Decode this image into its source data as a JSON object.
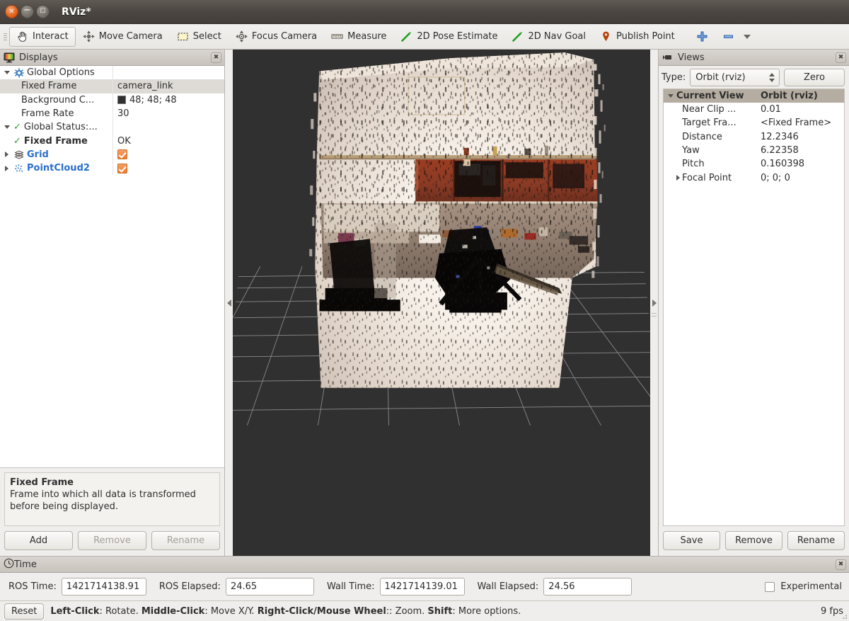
{
  "window": {
    "title": "RViz*",
    "controls": {
      "close": "close-button",
      "minimize": "minimize-button",
      "maximize": "maximize-button"
    }
  },
  "toolbar": {
    "items": [
      {
        "label": "Interact",
        "icon": "hand-cursor-icon",
        "active": true
      },
      {
        "label": "Move Camera",
        "icon": "move-camera-icon",
        "active": false
      },
      {
        "label": "Select",
        "icon": "select-rectangle-icon",
        "active": false
      },
      {
        "label": "Focus Camera",
        "icon": "focus-camera-icon",
        "active": false
      },
      {
        "label": "Measure",
        "icon": "ruler-icon",
        "active": false
      },
      {
        "label": "2D Pose Estimate",
        "icon": "pose-arrow-icon",
        "active": false
      },
      {
        "label": "2D Nav Goal",
        "icon": "nav-goal-arrow-icon",
        "active": false
      },
      {
        "label": "Publish Point",
        "icon": "map-pin-icon",
        "active": false
      }
    ],
    "add_tool_icon": "plus-icon",
    "remove_tool_icon": "minus-icon",
    "overflow_icon": "chevron-down-icon"
  },
  "displays_panel": {
    "title": "Displays",
    "icon": "displays-monitor-icon",
    "close_icon": "close-icon",
    "rows": [
      {
        "indent": 0,
        "twisty": "down",
        "icon": "gear-icon",
        "status": "",
        "label": "Global Options",
        "value": "",
        "value_kind": "none",
        "selected": false,
        "link": false
      },
      {
        "indent": 1,
        "twisty": "none",
        "icon": "none",
        "status": "",
        "label": "Fixed Frame",
        "value": "camera_link",
        "value_kind": "text",
        "selected": true,
        "link": false
      },
      {
        "indent": 1,
        "twisty": "none",
        "icon": "none",
        "status": "",
        "label": "Background C...",
        "value": "48; 48; 48",
        "value_kind": "color",
        "selected": false,
        "link": false
      },
      {
        "indent": 1,
        "twisty": "none",
        "icon": "none",
        "status": "",
        "label": "Frame Rate",
        "value": "30",
        "value_kind": "text",
        "selected": false,
        "link": false
      },
      {
        "indent": 0,
        "twisty": "down",
        "icon": "none",
        "status": "ok",
        "label": "Global Status:...",
        "value": "",
        "value_kind": "none",
        "selected": false,
        "link": false
      },
      {
        "indent": 1,
        "twisty": "none",
        "icon": "none",
        "status": "ok",
        "label": "Fixed Frame",
        "value": "OK",
        "value_kind": "text",
        "selected": false,
        "link": false
      },
      {
        "indent": 0,
        "twisty": "right",
        "icon": "grid-icon",
        "status": "",
        "label": "Grid",
        "value": "checked",
        "value_kind": "checkbox",
        "selected": false,
        "link": true
      },
      {
        "indent": 0,
        "twisty": "right",
        "icon": "pointcloud-icon",
        "status": "",
        "label": "PointCloud2",
        "value": "checked",
        "value_kind": "checkbox",
        "selected": false,
        "link": true
      }
    ],
    "background_color_hex": "#303030",
    "description": {
      "title": "Fixed Frame",
      "text": "Frame into which all data is transformed before being displayed."
    },
    "buttons": [
      {
        "label": "Add",
        "enabled": true
      },
      {
        "label": "Remove",
        "enabled": false
      },
      {
        "label": "Rename",
        "enabled": false
      }
    ]
  },
  "views_panel": {
    "title": "Views",
    "icon": "camera-icon",
    "close_icon": "close-icon",
    "type_label": "Type:",
    "type_value": "Orbit (rviz)",
    "zero_button": "Zero",
    "header": {
      "name": "Current View",
      "value": "Orbit (rviz)"
    },
    "rows": [
      {
        "indent": 1,
        "twisty": "none",
        "label": "Near Clip ...",
        "value": "0.01"
      },
      {
        "indent": 1,
        "twisty": "none",
        "label": "Target Fra...",
        "value": "<Fixed Frame>"
      },
      {
        "indent": 1,
        "twisty": "none",
        "label": "Distance",
        "value": "12.2346"
      },
      {
        "indent": 1,
        "twisty": "none",
        "label": "Yaw",
        "value": "6.22358"
      },
      {
        "indent": 1,
        "twisty": "none",
        "label": "Pitch",
        "value": "0.160398"
      },
      {
        "indent": 1,
        "twisty": "right",
        "label": "Focal Point",
        "value": "0; 0; 0"
      }
    ],
    "buttons": [
      {
        "label": "Save",
        "enabled": true
      },
      {
        "label": "Remove",
        "enabled": true
      },
      {
        "label": "Rename",
        "enabled": true
      }
    ]
  },
  "viewport": {
    "background_hex": "#303030",
    "grid_color_hex": "#a0a0a0",
    "content_description": "3D point cloud of an indoor room: white wall, dark red cabinets, dark furniture"
  },
  "time_panel": {
    "title": "Time",
    "icon": "clock-icon",
    "close_icon": "close-icon",
    "fields": [
      {
        "label": "ROS Time:",
        "value": "1421714138.91"
      },
      {
        "label": "ROS Elapsed:",
        "value": "24.65"
      },
      {
        "label": "Wall Time:",
        "value": "1421714139.01"
      },
      {
        "label": "Wall Elapsed:",
        "value": "24.56"
      }
    ],
    "experimental_label": "Experimental",
    "experimental_checked": false
  },
  "statusbar": {
    "reset_button": "Reset",
    "hint_parts": [
      {
        "text": "Left-Click",
        "bold": true
      },
      {
        "text": ": Rotate. ",
        "bold": false
      },
      {
        "text": "Middle-Click",
        "bold": true
      },
      {
        "text": ": Move X/Y. ",
        "bold": false
      },
      {
        "text": "Right-Click/Mouse Wheel",
        "bold": true
      },
      {
        "text": ":: Zoom. ",
        "bold": false
      },
      {
        "text": "Shift",
        "bold": true
      },
      {
        "text": ": More options.",
        "bold": false
      }
    ],
    "fps": "9 fps"
  }
}
